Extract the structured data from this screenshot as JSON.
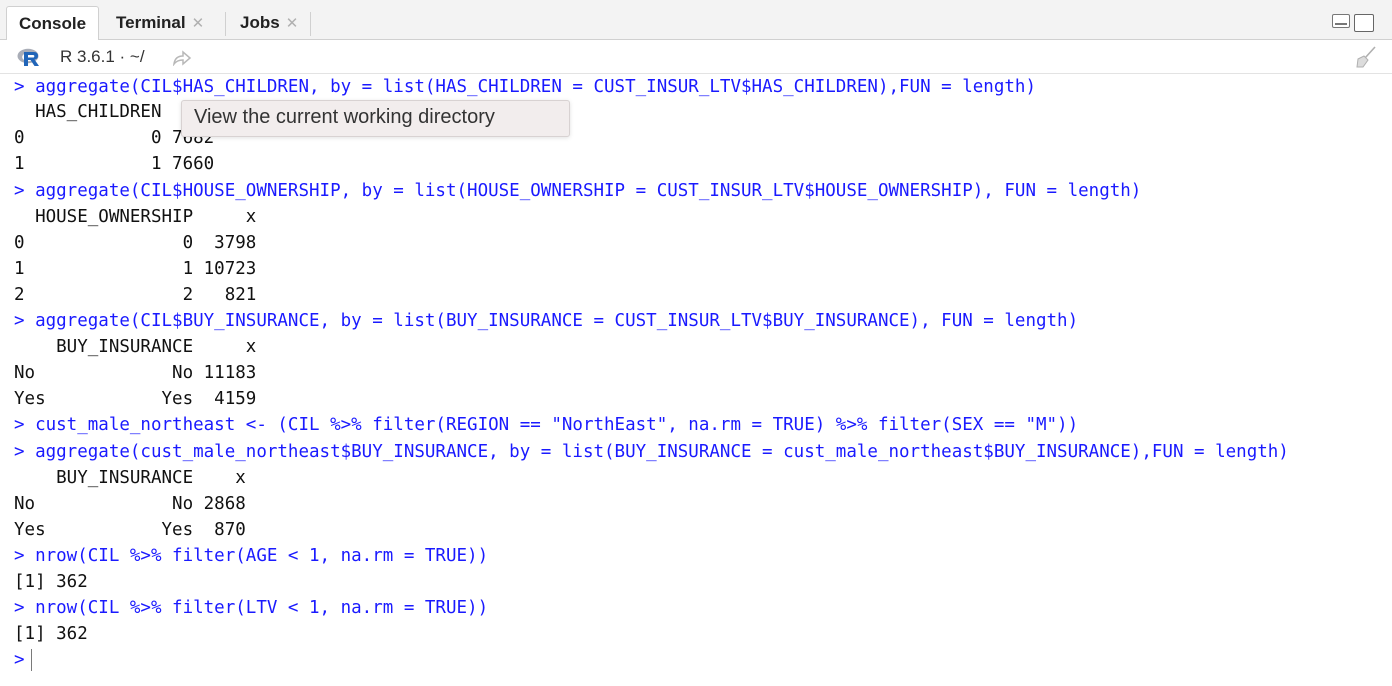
{
  "tabs": [
    {
      "label": "Console",
      "active": true,
      "closable": false
    },
    {
      "label": "Terminal",
      "active": false,
      "closable": true
    },
    {
      "label": "Jobs",
      "active": false,
      "closable": true
    }
  ],
  "toolbar": {
    "r_version": "R 3.6.1",
    "working_dir": "· ~/",
    "goto_icon": "arrow-goto-icon",
    "clear_icon": "broom-icon"
  },
  "console": {
    "lines": [
      {
        "kind": "cmd",
        "text": "> aggregate(CIL$HAS_CHILDREN, by = list(HAS_CHILDREN = CUST_INSUR_LTV$HAS_CHILDREN),FUN = length)"
      },
      {
        "kind": "out",
        "text": "  HAS_CHILDREN    x"
      },
      {
        "kind": "out",
        "text": "0            0 7682"
      },
      {
        "kind": "out",
        "text": "1            1 7660"
      },
      {
        "kind": "cmd",
        "text": "> aggregate(CIL$HOUSE_OWNERSHIP, by = list(HOUSE_OWNERSHIP = CUST_INSUR_LTV$HOUSE_OWNERSHIP), FUN = length)"
      },
      {
        "kind": "out",
        "text": "  HOUSE_OWNERSHIP     x"
      },
      {
        "kind": "out",
        "text": "0               0  3798"
      },
      {
        "kind": "out",
        "text": "1               1 10723"
      },
      {
        "kind": "out",
        "text": "2               2   821"
      },
      {
        "kind": "cmd",
        "text": "> aggregate(CIL$BUY_INSURANCE, by = list(BUY_INSURANCE = CUST_INSUR_LTV$BUY_INSURANCE), FUN = length)"
      },
      {
        "kind": "out",
        "text": "    BUY_INSURANCE     x"
      },
      {
        "kind": "out",
        "text": "No             No 11183"
      },
      {
        "kind": "out",
        "text": "Yes           Yes  4159"
      },
      {
        "kind": "cmd",
        "text": "> cust_male_northeast <- (CIL %>% filter(REGION == \"NorthEast\", na.rm = TRUE) %>% filter(SEX == \"M\"))"
      },
      {
        "kind": "cmd",
        "text": "> aggregate(cust_male_northeast$BUY_INSURANCE, by = list(BUY_INSURANCE = cust_male_northeast$BUY_INSURANCE),FUN = length)"
      },
      {
        "kind": "out",
        "text": "    BUY_INSURANCE    x"
      },
      {
        "kind": "out",
        "text": "No             No 2868"
      },
      {
        "kind": "out",
        "text": "Yes           Yes  870"
      },
      {
        "kind": "cmd",
        "text": "> nrow(CIL %>% filter(AGE < 1, na.rm = TRUE))"
      },
      {
        "kind": "out",
        "text": "[1] 362"
      },
      {
        "kind": "cmd",
        "text": "> nrow(CIL %>% filter(LTV < 1, na.rm = TRUE))"
      },
      {
        "kind": "out",
        "text": "[1] 362"
      }
    ],
    "prompt": ">"
  },
  "tooltip": "View the current working directory",
  "colors": {
    "command": "#1a1aff",
    "output": "#111111",
    "tooltip_bg": "#f2eded"
  }
}
